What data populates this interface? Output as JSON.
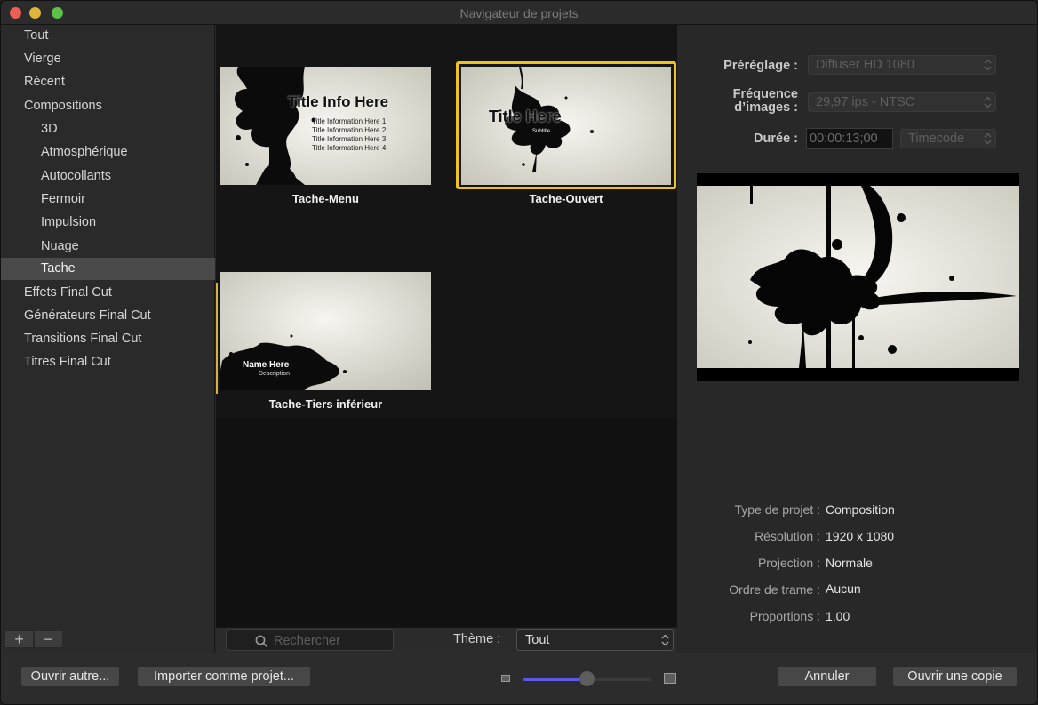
{
  "window": {
    "title": "Navigateur de projets"
  },
  "sidebar": {
    "items": [
      {
        "label": "Tout"
      },
      {
        "label": "Vierge"
      },
      {
        "label": "Récent"
      },
      {
        "label": "Compositions"
      },
      {
        "label": "3D"
      },
      {
        "label": "Atmosphérique"
      },
      {
        "label": "Autocollants"
      },
      {
        "label": "Fermoir"
      },
      {
        "label": "Impulsion"
      },
      {
        "label": "Nuage"
      },
      {
        "label": "Tache"
      },
      {
        "label": "Effets Final Cut"
      },
      {
        "label": "Générateurs Final Cut"
      },
      {
        "label": "Transitions Final Cut"
      },
      {
        "label": "Titres Final Cut"
      }
    ],
    "selected": "Tache",
    "add_label": "+",
    "remove_label": "−"
  },
  "browser": {
    "templates": [
      {
        "name": "Tache-Menu",
        "title": "Title Info Here",
        "lines": [
          "Title Information Here 1",
          "Title Information Here 2",
          "Title Information Here 3",
          "Title Information Here 4"
        ]
      },
      {
        "name": "Tache-Ouvert",
        "title": "Title Here",
        "subtitle": "Subtitle",
        "selected": true
      },
      {
        "name": "Tache-Tiers inférieur",
        "title": "Name Here",
        "subtitle": "Description"
      }
    ],
    "search": {
      "placeholder": "Rechercher"
    },
    "theme": {
      "label": "Thème :",
      "value": "Tout"
    }
  },
  "inspector": {
    "preset": {
      "label": "Préréglage :",
      "value": "Diffuser HD 1080"
    },
    "frame_rate": {
      "label_line1": "Fréquence",
      "label_line2": "d’images :",
      "value": "29,97 ips - NTSC"
    },
    "duration": {
      "label": "Durée :",
      "value": "00:00:13;00",
      "format": "Timecode"
    },
    "info": [
      {
        "label": "Type de projet :",
        "value": "Composition"
      },
      {
        "label": "Résolution :",
        "value": "1920 x 1080"
      },
      {
        "label": "Projection :",
        "value": "Normale"
      },
      {
        "label": "Ordre de trame :",
        "value": "Aucun"
      },
      {
        "label": "Proportions :",
        "value": "1,00"
      }
    ]
  },
  "footer": {
    "open_other": "Ouvrir autre...",
    "import_project": "Importer comme projet...",
    "cancel": "Annuler",
    "open_copy": "Ouvrir une copie",
    "thumbnail_size": 0.5
  },
  "colors": {
    "selection": "#f2c21c",
    "slider": "#5b5be8",
    "close": "#ec5f57",
    "minimize": "#e0b43b",
    "maximize": "#5bc148"
  }
}
